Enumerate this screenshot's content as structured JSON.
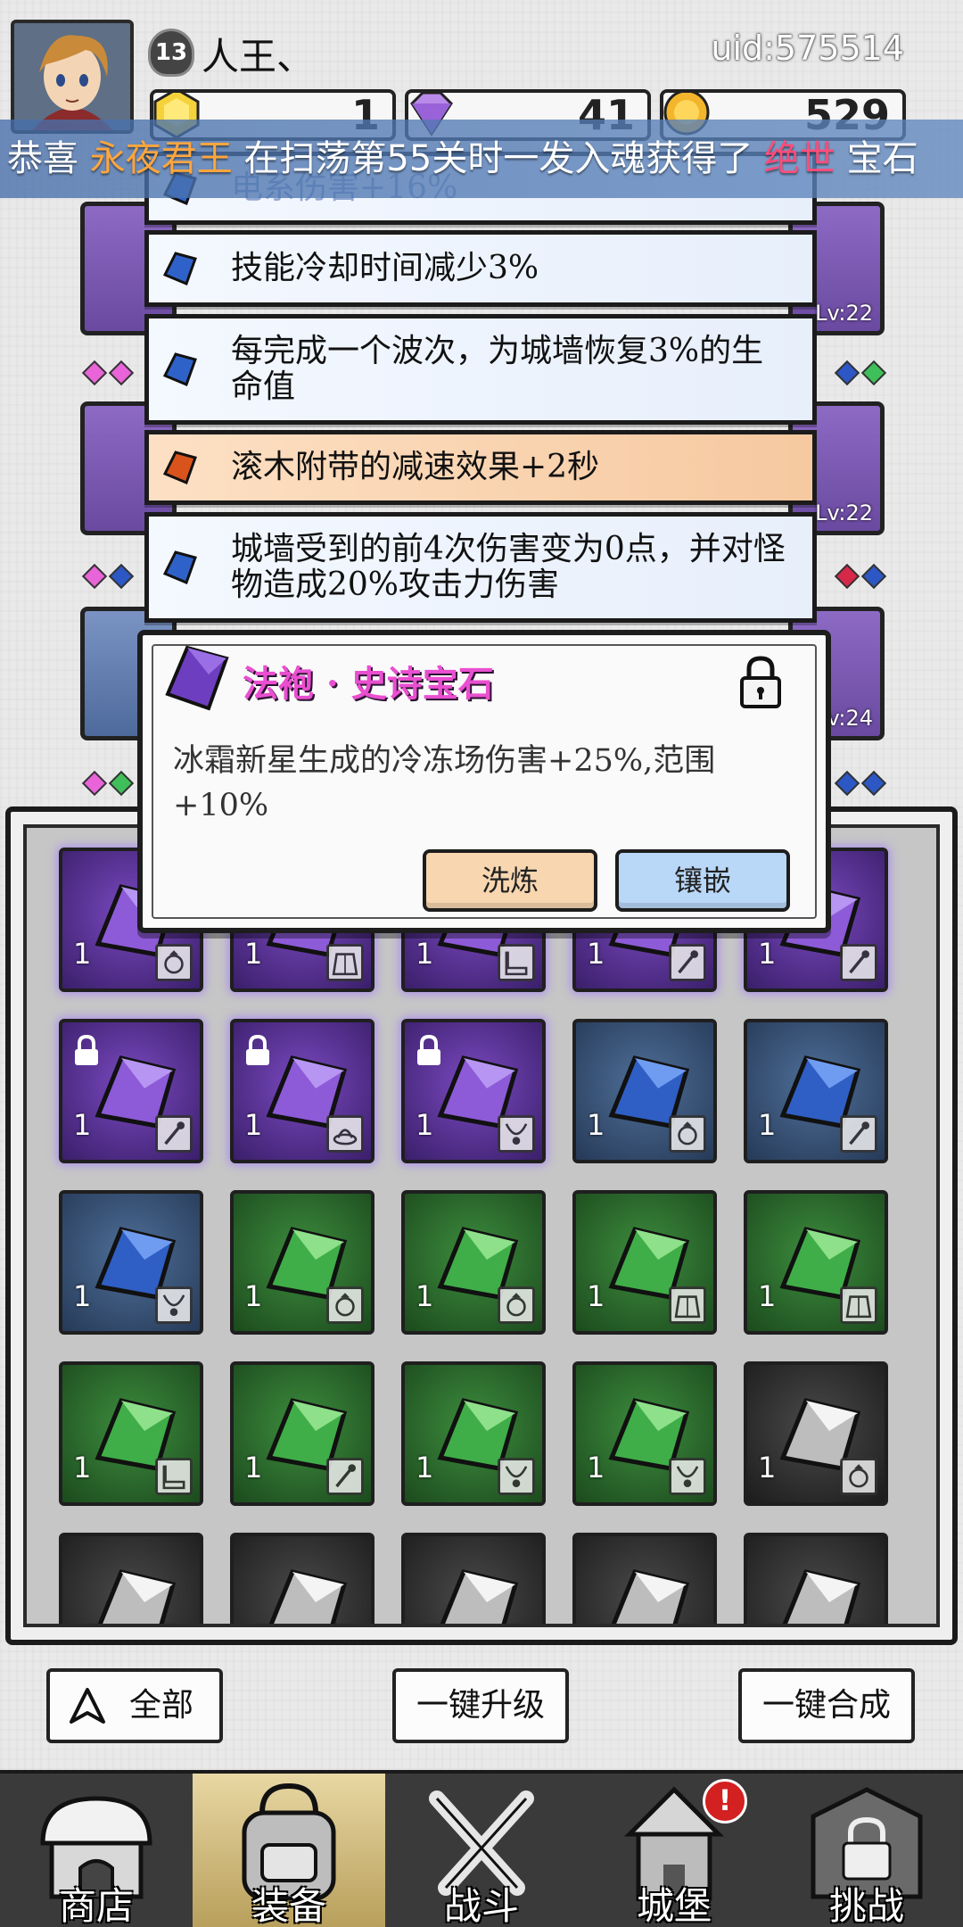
{
  "player": {
    "level": "13",
    "name": "人王、",
    "uid": "uid:575514"
  },
  "resources": {
    "energy": "1",
    "gems": "41",
    "coins": "529"
  },
  "ticker": {
    "prefix": "恭喜 ",
    "player_name": "永夜君王",
    "middle": " 在扫荡第55关时一发入魂获得了 ",
    "rarity": "绝世",
    "suffix": " 宝石"
  },
  "equipment_levels": [
    "Lv:22",
    "Lv:22",
    "Lv:24"
  ],
  "affixes": [
    {
      "text": "电系伤害+16%",
      "color": "blue"
    },
    {
      "text": "技能冷却时间减少3%",
      "color": "blue"
    },
    {
      "text": "每完成一个波次，为城墙恢复3%的生命值",
      "color": "blue"
    },
    {
      "text": "滚木附带的减速效果+2秒",
      "color": "orange"
    },
    {
      "text": "城墙受到的前4次伤害变为0点，并对怪物造成20%攻击力伤害",
      "color": "blue"
    }
  ],
  "tooltip": {
    "title": "法袍 · 史诗宝石",
    "description": "冰霜新星生成的冷冻场伤害+25%,范围+10%",
    "refine_label": "洗炼",
    "inlay_label": "镶嵌"
  },
  "inventory": [
    {
      "rarity": "purple",
      "count": "1",
      "slot": "ring",
      "locked": false
    },
    {
      "rarity": "purple",
      "count": "1",
      "slot": "robe",
      "locked": false
    },
    {
      "rarity": "purple",
      "count": "1",
      "slot": "boots",
      "locked": false
    },
    {
      "rarity": "purple",
      "count": "1",
      "slot": "wand",
      "locked": false
    },
    {
      "rarity": "purple",
      "count": "1",
      "slot": "wand",
      "locked": false
    },
    {
      "rarity": "purple",
      "count": "1",
      "slot": "wand",
      "locked": true
    },
    {
      "rarity": "purple",
      "count": "1",
      "slot": "hat",
      "locked": true
    },
    {
      "rarity": "purple",
      "count": "1",
      "slot": "necklace",
      "locked": true
    },
    {
      "rarity": "blue",
      "count": "1",
      "slot": "ring",
      "locked": false
    },
    {
      "rarity": "blue",
      "count": "1",
      "slot": "wand",
      "locked": false
    },
    {
      "rarity": "blue",
      "count": "1",
      "slot": "necklace",
      "locked": false
    },
    {
      "rarity": "green",
      "count": "1",
      "slot": "ring",
      "locked": false
    },
    {
      "rarity": "green",
      "count": "1",
      "slot": "ring",
      "locked": false
    },
    {
      "rarity": "green",
      "count": "1",
      "slot": "robe",
      "locked": false
    },
    {
      "rarity": "green",
      "count": "1",
      "slot": "robe",
      "locked": false
    },
    {
      "rarity": "green",
      "count": "1",
      "slot": "boots",
      "locked": false
    },
    {
      "rarity": "green",
      "count": "1",
      "slot": "wand",
      "locked": false
    },
    {
      "rarity": "green",
      "count": "1",
      "slot": "necklace",
      "locked": false
    },
    {
      "rarity": "green",
      "count": "1",
      "slot": "necklace",
      "locked": false
    },
    {
      "rarity": "white",
      "count": "1",
      "slot": "ring",
      "locked": false
    },
    {
      "rarity": "white",
      "count": "",
      "slot": "",
      "locked": false
    },
    {
      "rarity": "white",
      "count": "",
      "slot": "",
      "locked": false
    },
    {
      "rarity": "white",
      "count": "",
      "slot": "",
      "locked": false
    },
    {
      "rarity": "white",
      "count": "",
      "slot": "",
      "locked": false
    },
    {
      "rarity": "white",
      "count": "",
      "slot": "",
      "locked": false
    }
  ],
  "actions": {
    "all_label": "全部",
    "upgrade_label": "一键升级",
    "merge_label": "一键合成"
  },
  "nav": {
    "shop": "商店",
    "equipment": "装备",
    "battle": "战斗",
    "castle": "城堡",
    "challenge": "挑战",
    "castle_badge": "!"
  },
  "colors": {
    "epic_purple": "#7a49c0",
    "rare_blue": "#4f6f98",
    "uncommon_green": "#3d8d3e",
    "common_white": "#4a4a4a",
    "title_pink": "#e94fd0"
  }
}
